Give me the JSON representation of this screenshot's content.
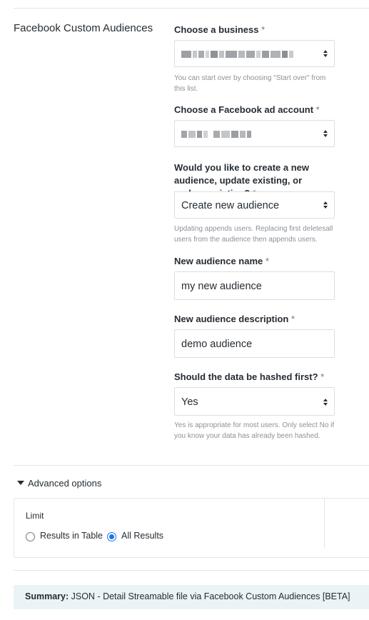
{
  "section": {
    "title": "Facebook Custom Audiences"
  },
  "business": {
    "label": "Choose a business",
    "required": "*",
    "value": "",
    "help": "You can start over by choosing \"Start over\" from this list."
  },
  "ad_account": {
    "label": "Choose a Facebook ad account",
    "required": "*",
    "value": ""
  },
  "audience_action": {
    "label": "Would you like to create a new audience, update existing, or replace existing?",
    "required": "*",
    "value": "Create new audience",
    "help": "Updating appends users. Replacing first deletesall users from the audience then appends users."
  },
  "audience_name": {
    "label": "New audience name",
    "required": "*",
    "value": "my new audience"
  },
  "audience_description": {
    "label": "New audience description",
    "required": "*",
    "value": "demo audience"
  },
  "hash": {
    "label": "Should the data be hashed first?",
    "required": "*",
    "value": "Yes",
    "help": "Yes is appropriate for most users. Only select No if you know your data has already been hashed."
  },
  "advanced": {
    "label": "Advanced options",
    "limit_label": "Limit",
    "options": [
      {
        "label": "Results in Table",
        "checked": false
      },
      {
        "label": "All Results",
        "checked": true
      }
    ]
  },
  "summary": {
    "prefix": "Summary:",
    "text": "JSON - Detail Streamable file via Facebook Custom Audiences [BETA]"
  }
}
